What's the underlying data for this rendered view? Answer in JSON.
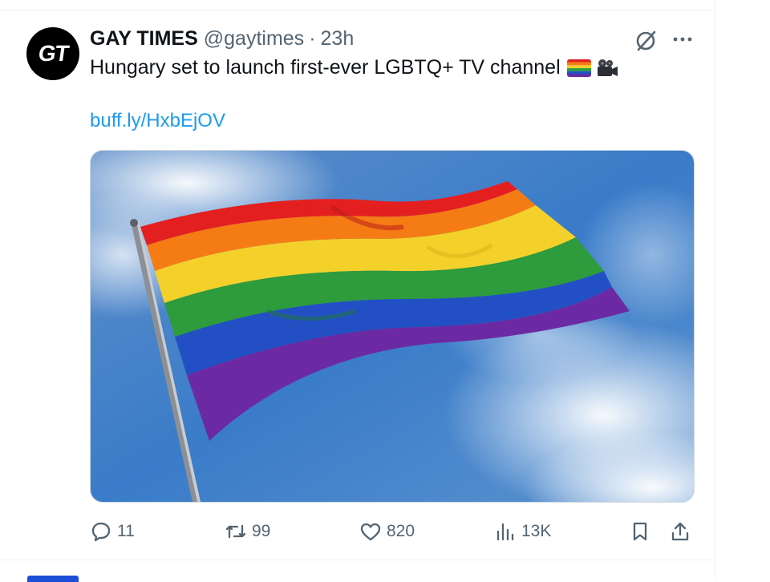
{
  "tweet": {
    "avatar_text": "GT",
    "display_name": "GAY TIMES",
    "handle": "@gaytimes",
    "separator": "·",
    "time": "23h",
    "text": "Hungary set to launch first-ever LGBTQ+ TV channel",
    "emojis": [
      "rainbow-flag",
      "movie-camera"
    ],
    "link": "buff.ly/HxbEjOV",
    "media_alt": "rainbow-flag-photo"
  },
  "actions": {
    "reply_count": "11",
    "retweet_count": "99",
    "like_count": "820",
    "views_count": "13K"
  },
  "colors": {
    "link": "#1d9bf0",
    "secondary_text": "#536471",
    "flag": [
      "#e41f1f",
      "#f57b14",
      "#f4d12a",
      "#2e9b3c",
      "#2250c4",
      "#6b2aa3"
    ]
  }
}
